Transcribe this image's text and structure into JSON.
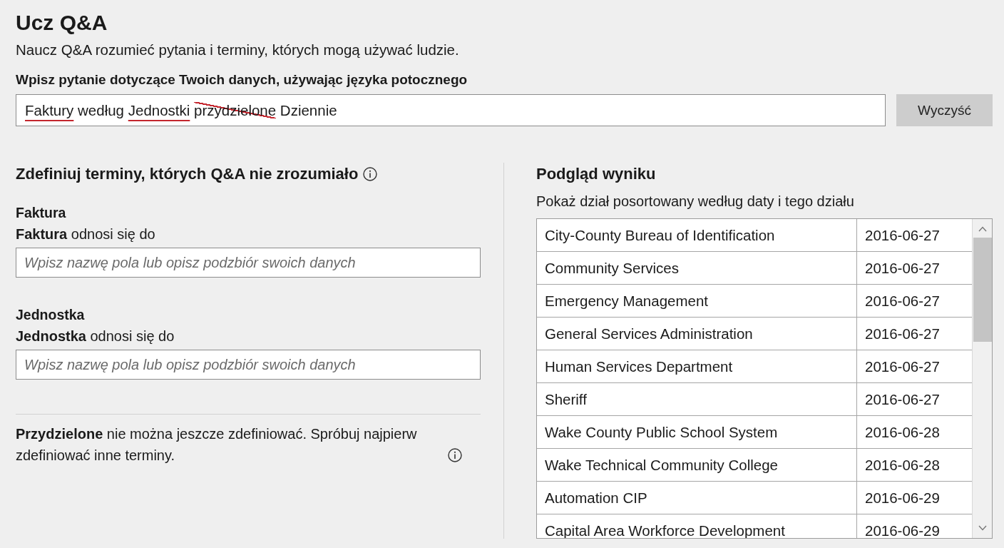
{
  "page": {
    "title": "Ucz Q&A",
    "subtitle": "Naucz Q&A rozumieć pytania i terminy, których mogą używać ludzie."
  },
  "question": {
    "label": "Wpisz pytanie dotyczące Twoich danych, używając języka potocznego",
    "words": [
      {
        "text": "Faktury",
        "kind": "unrecognized"
      },
      {
        "text": "według",
        "kind": "plain"
      },
      {
        "text": "Jednostki",
        "kind": "unrecognized"
      },
      {
        "text": "przydzielone",
        "kind": "undefinable"
      },
      {
        "text": "Dziennie",
        "kind": "plain"
      }
    ],
    "clear_button": "Wyczyść"
  },
  "define_terms": {
    "heading": "Zdefiniuj terminy, których Q&A nie zrozumiało",
    "terms": [
      {
        "title": "Faktura",
        "prompt": "**Faktura** odnosi się do",
        "placeholder": "Wpisz nazwę pola lub opisz podzbiór swoich danych"
      },
      {
        "title": "Jednostka",
        "prompt": "**Jednostka** odnosi się do",
        "placeholder": "Wpisz nazwę pola lub opisz podzbiór swoich danych"
      }
    ],
    "note": "**Przydzielone** nie można jeszcze zdefiniować. Spróbuj najpierw zdefiniować inne terminy."
  },
  "preview": {
    "heading": "Podgląd wyniku",
    "description": "Pokaż dział posortowany według daty i tego działu",
    "table": {
      "rows": [
        [
          "City-County Bureau of Identification",
          "2016-06-27"
        ],
        [
          "Community Services",
          "2016-06-27"
        ],
        [
          "Emergency Management",
          "2016-06-27"
        ],
        [
          "General Services Administration",
          "2016-06-27"
        ],
        [
          "Human Services Department",
          "2016-06-27"
        ],
        [
          "Sheriff",
          "2016-06-27"
        ],
        [
          "Wake County Public School System",
          "2016-06-28"
        ],
        [
          "Wake Technical Community College",
          "2016-06-28"
        ],
        [
          "Automation CIP",
          "2016-06-29"
        ],
        [
          "Capital Area Workforce Development",
          "2016-06-29"
        ]
      ]
    }
  }
}
